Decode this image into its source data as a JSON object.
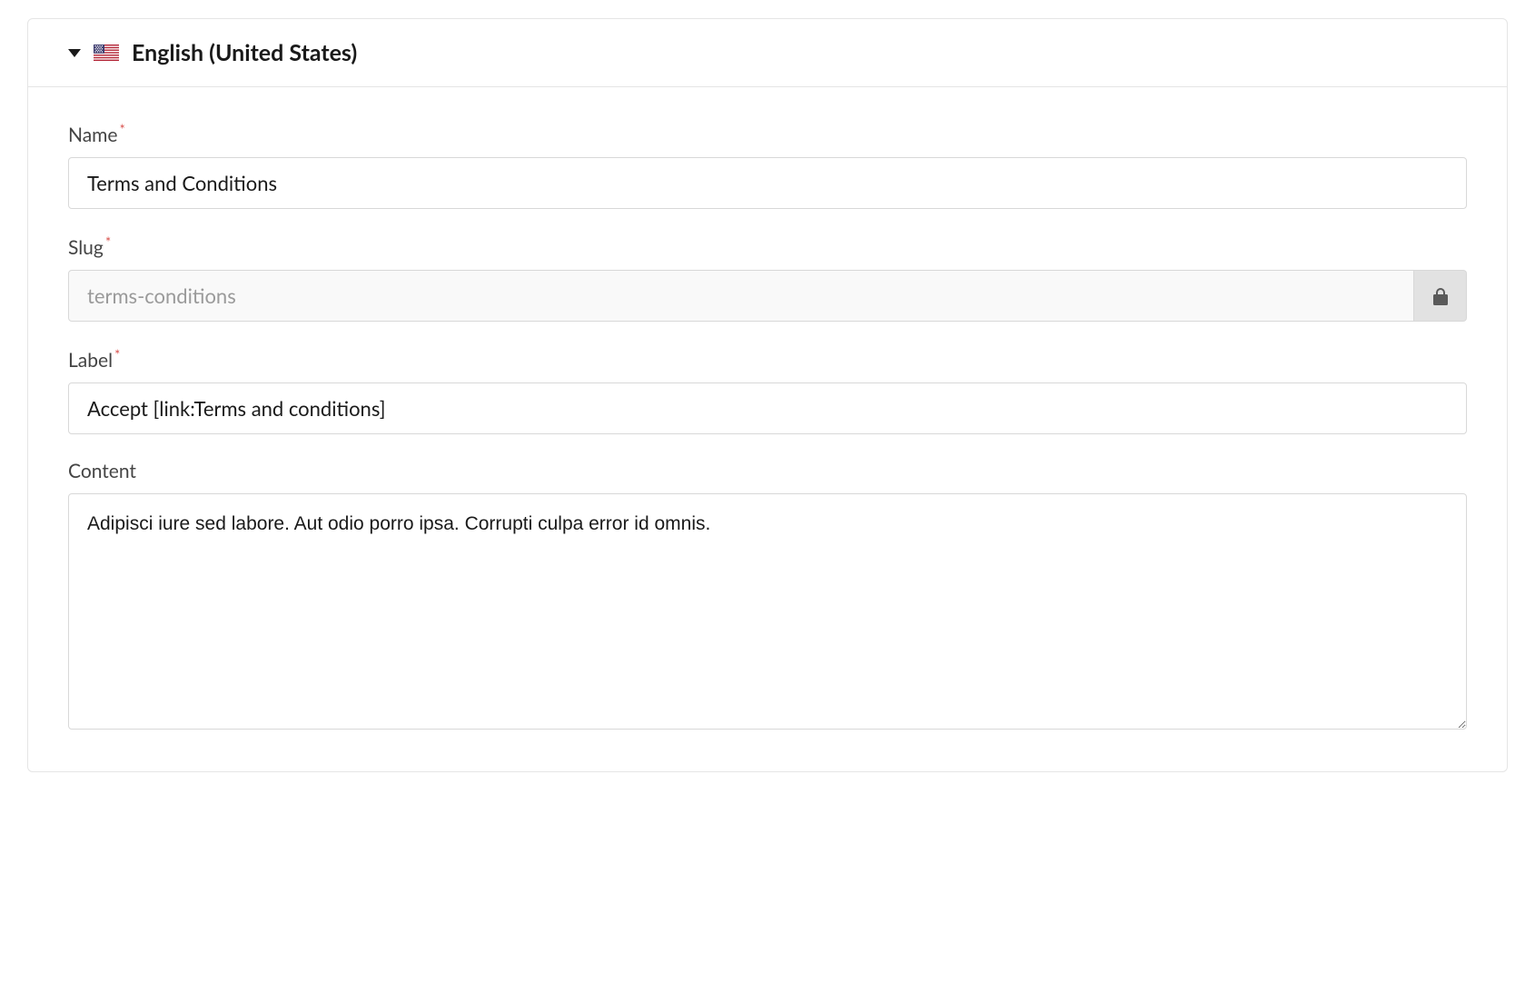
{
  "panel": {
    "header_title": "English (United States)"
  },
  "form": {
    "name": {
      "label": "Name",
      "value": "Terms and Conditions",
      "required_mark": "*"
    },
    "slug": {
      "label": "Slug",
      "value": "terms-conditions",
      "required_mark": "*"
    },
    "label_field": {
      "label": "Label",
      "value": "Accept [link:Terms and conditions]",
      "required_mark": "*"
    },
    "content": {
      "label": "Content",
      "value": "Adipisci iure sed labore. Aut odio porro ipsa. Corrupti culpa error id omnis."
    }
  }
}
